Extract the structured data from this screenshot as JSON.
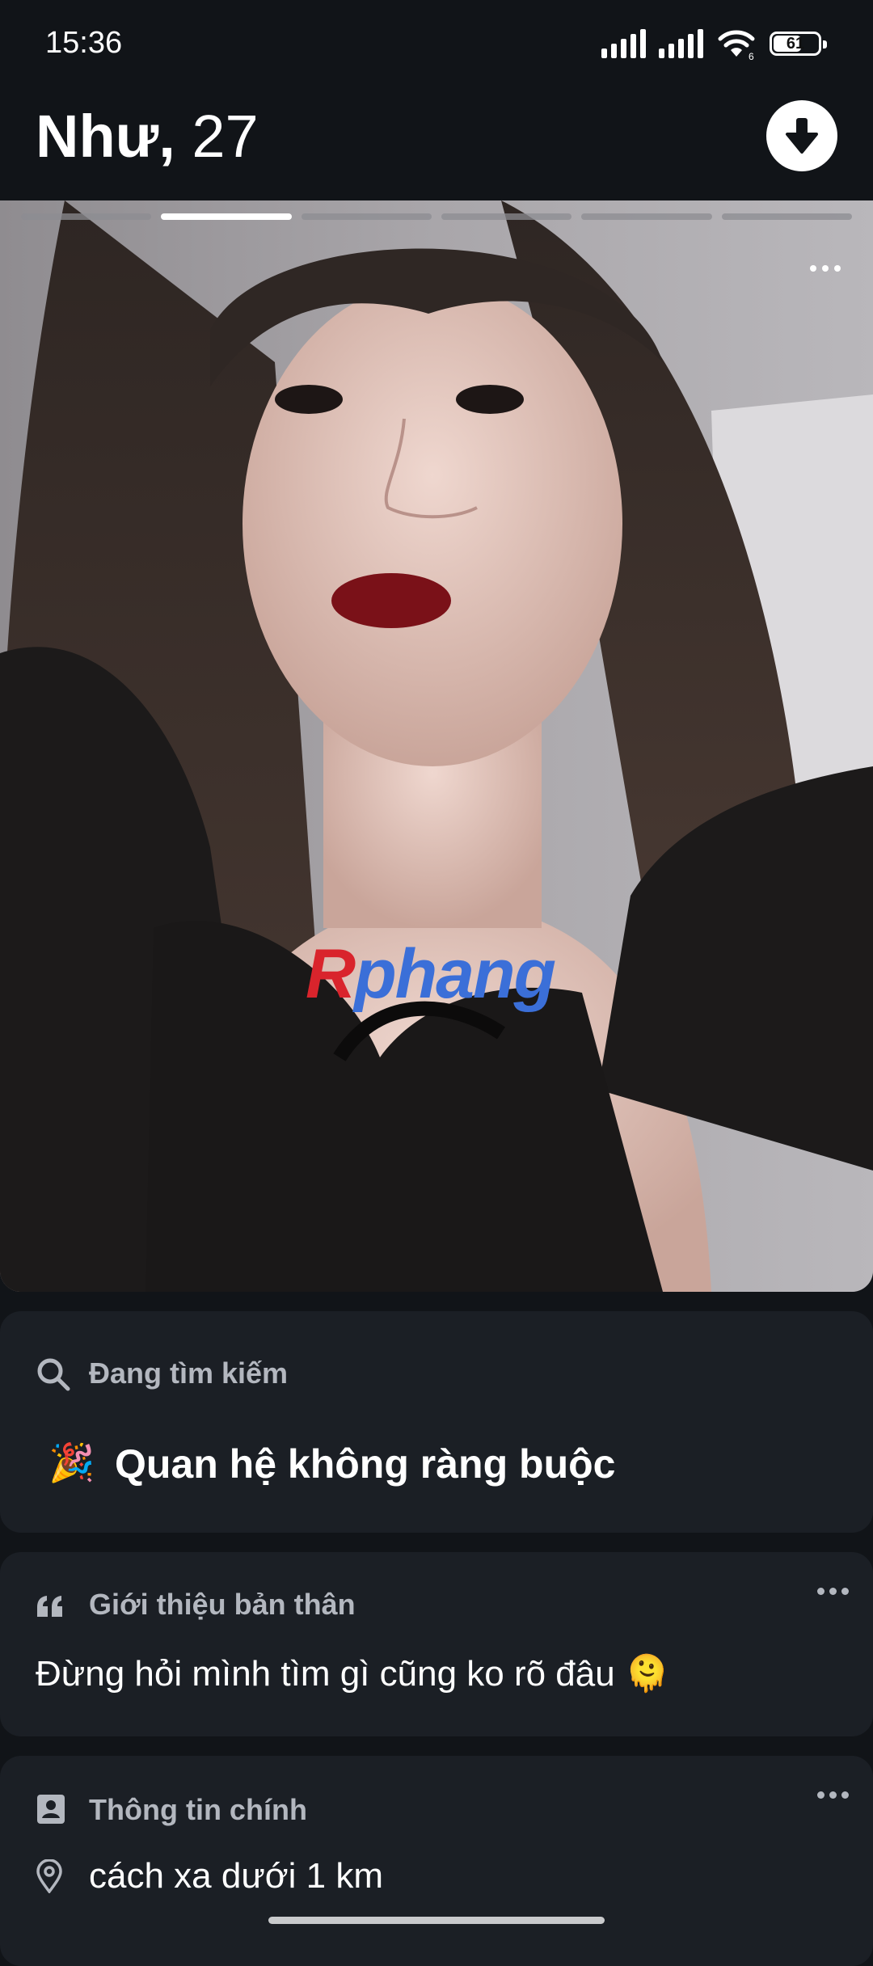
{
  "status_bar": {
    "time": "15:36",
    "battery_level": "61",
    "wifi_label": "6"
  },
  "profile": {
    "name": "Như,",
    "age": "27",
    "photo_count": 6,
    "active_photo_index": 1
  },
  "photo": {
    "watermark_part1": "R",
    "watermark_part2": "phang"
  },
  "looking_for": {
    "label": "Đang tìm kiếm",
    "emoji": "🎉",
    "value": "Quan hệ không ràng buộc"
  },
  "bio": {
    "label": "Giới thiệu bản thân",
    "text": "Đừng hỏi mình tìm gì cũng ko rõ đâu 🫠"
  },
  "basic_info": {
    "label": "Thông tin chính",
    "distance": "cách xa dưới 1 km"
  },
  "colors": {
    "background": "#111418",
    "card": "#1b1f25",
    "label": "#b3b7bf",
    "watermark_red": "#d9242c",
    "watermark_blue": "#3b6fd8"
  }
}
